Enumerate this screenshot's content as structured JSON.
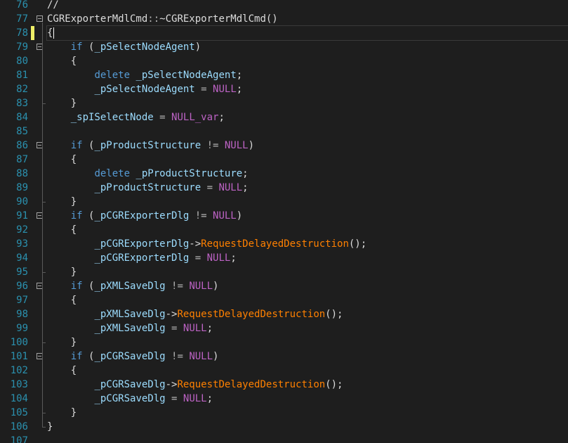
{
  "colors": {
    "background": "#1e1e1e",
    "line_number": "#2b91af",
    "keyword": "#569cd6",
    "variable": "#9cdcfe",
    "method": "#ff8000",
    "macro": "#bd63c5",
    "text": "#dcdcdc",
    "modified_marker": "#efef67",
    "saved_marker": "#57a64a",
    "guide": "#5a5a5a"
  },
  "editor": {
    "current_line": "78",
    "lines": [
      {
        "n": "76",
        "fold": false,
        "mark": "none",
        "tokens": [
          {
            "t": "//",
            "c": "def"
          }
        ]
      },
      {
        "n": "77",
        "fold": true,
        "mark": "none",
        "tokens": [
          {
            "t": "CGRExporterMdlCmd",
            "c": "fn"
          },
          {
            "t": "::",
            "c": "op"
          },
          {
            "t": "~CGRExporterMdlCmd",
            "c": "fn"
          },
          {
            "t": "()",
            "c": "punct"
          }
        ]
      },
      {
        "n": "78",
        "fold": false,
        "mark": "modified",
        "tokens": [
          {
            "t": "{",
            "c": "punct"
          }
        ]
      },
      {
        "n": "79",
        "fold": true,
        "mark": "none",
        "tokens": [
          {
            "t": "    ",
            "c": "def"
          },
          {
            "t": "if",
            "c": "kw"
          },
          {
            "t": " (",
            "c": "punct"
          },
          {
            "t": "_pSelectNodeAgent",
            "c": "var"
          },
          {
            "t": ")",
            "c": "punct"
          }
        ]
      },
      {
        "n": "80",
        "fold": false,
        "mark": "none",
        "tokens": [
          {
            "t": "    {",
            "c": "punct"
          }
        ]
      },
      {
        "n": "81",
        "fold": false,
        "mark": "none",
        "tokens": [
          {
            "t": "        ",
            "c": "def"
          },
          {
            "t": "delete",
            "c": "kw"
          },
          {
            "t": " ",
            "c": "def"
          },
          {
            "t": "_pSelectNodeAgent",
            "c": "var"
          },
          {
            "t": ";",
            "c": "punct"
          }
        ]
      },
      {
        "n": "82",
        "fold": false,
        "mark": "none",
        "tokens": [
          {
            "t": "        ",
            "c": "def"
          },
          {
            "t": "_pSelectNodeAgent",
            "c": "var"
          },
          {
            "t": " = ",
            "c": "op"
          },
          {
            "t": "NULL",
            "c": "macro"
          },
          {
            "t": ";",
            "c": "punct"
          }
        ]
      },
      {
        "n": "83",
        "fold": false,
        "mark": "none",
        "tokens": [
          {
            "t": "    }",
            "c": "punct"
          }
        ]
      },
      {
        "n": "84",
        "fold": false,
        "mark": "none",
        "tokens": [
          {
            "t": "    ",
            "c": "def"
          },
          {
            "t": "_spISelectNode",
            "c": "var"
          },
          {
            "t": " = ",
            "c": "op"
          },
          {
            "t": "NULL_var",
            "c": "macro"
          },
          {
            "t": ";",
            "c": "punct"
          }
        ]
      },
      {
        "n": "85",
        "fold": false,
        "mark": "none",
        "tokens": []
      },
      {
        "n": "86",
        "fold": true,
        "mark": "none",
        "tokens": [
          {
            "t": "    ",
            "c": "def"
          },
          {
            "t": "if",
            "c": "kw"
          },
          {
            "t": " (",
            "c": "punct"
          },
          {
            "t": "_pProductStructure",
            "c": "var"
          },
          {
            "t": " != ",
            "c": "op"
          },
          {
            "t": "NULL",
            "c": "macro"
          },
          {
            "t": ")",
            "c": "punct"
          }
        ]
      },
      {
        "n": "87",
        "fold": false,
        "mark": "none",
        "tokens": [
          {
            "t": "    {",
            "c": "punct"
          }
        ]
      },
      {
        "n": "88",
        "fold": false,
        "mark": "none",
        "tokens": [
          {
            "t": "        ",
            "c": "def"
          },
          {
            "t": "delete",
            "c": "kw"
          },
          {
            "t": " ",
            "c": "def"
          },
          {
            "t": "_pProductStructure",
            "c": "var"
          },
          {
            "t": ";",
            "c": "punct"
          }
        ]
      },
      {
        "n": "89",
        "fold": false,
        "mark": "none",
        "tokens": [
          {
            "t": "        ",
            "c": "def"
          },
          {
            "t": "_pProductStructure",
            "c": "var"
          },
          {
            "t": " = ",
            "c": "op"
          },
          {
            "t": "NULL",
            "c": "macro"
          },
          {
            "t": ";",
            "c": "punct"
          }
        ]
      },
      {
        "n": "90",
        "fold": false,
        "mark": "none",
        "tokens": [
          {
            "t": "    }",
            "c": "punct"
          }
        ]
      },
      {
        "n": "91",
        "fold": true,
        "mark": "none",
        "tokens": [
          {
            "t": "    ",
            "c": "def"
          },
          {
            "t": "if",
            "c": "kw"
          },
          {
            "t": " (",
            "c": "punct"
          },
          {
            "t": "_pCGRExporterDlg",
            "c": "var"
          },
          {
            "t": " != ",
            "c": "op"
          },
          {
            "t": "NULL",
            "c": "macro"
          },
          {
            "t": ")",
            "c": "punct"
          }
        ]
      },
      {
        "n": "92",
        "fold": false,
        "mark": "none",
        "tokens": [
          {
            "t": "    {",
            "c": "punct"
          }
        ]
      },
      {
        "n": "93",
        "fold": false,
        "mark": "none",
        "tokens": [
          {
            "t": "        ",
            "c": "def"
          },
          {
            "t": "_pCGRExporterDlg",
            "c": "var"
          },
          {
            "t": "->",
            "c": "ptr"
          },
          {
            "t": "RequestDelayedDestruction",
            "c": "method"
          },
          {
            "t": "();",
            "c": "punct"
          }
        ]
      },
      {
        "n": "94",
        "fold": false,
        "mark": "none",
        "tokens": [
          {
            "t": "        ",
            "c": "def"
          },
          {
            "t": "_pCGRExporterDlg",
            "c": "var"
          },
          {
            "t": " = ",
            "c": "op"
          },
          {
            "t": "NULL",
            "c": "macro"
          },
          {
            "t": ";",
            "c": "punct"
          }
        ]
      },
      {
        "n": "95",
        "fold": false,
        "mark": "none",
        "tokens": [
          {
            "t": "    }",
            "c": "punct"
          }
        ]
      },
      {
        "n": "96",
        "fold": true,
        "mark": "none",
        "tokens": [
          {
            "t": "    ",
            "c": "def"
          },
          {
            "t": "if",
            "c": "kw"
          },
          {
            "t": " (",
            "c": "punct"
          },
          {
            "t": "_pXMLSaveDlg",
            "c": "var"
          },
          {
            "t": " != ",
            "c": "op"
          },
          {
            "t": "NULL",
            "c": "macro"
          },
          {
            "t": ")",
            "c": "punct"
          }
        ]
      },
      {
        "n": "97",
        "fold": false,
        "mark": "none",
        "tokens": [
          {
            "t": "    {",
            "c": "punct"
          }
        ]
      },
      {
        "n": "98",
        "fold": false,
        "mark": "none",
        "tokens": [
          {
            "t": "        ",
            "c": "def"
          },
          {
            "t": "_pXMLSaveDlg",
            "c": "var"
          },
          {
            "t": "->",
            "c": "ptr"
          },
          {
            "t": "RequestDelayedDestruction",
            "c": "method"
          },
          {
            "t": "();",
            "c": "punct"
          }
        ]
      },
      {
        "n": "99",
        "fold": false,
        "mark": "none",
        "tokens": [
          {
            "t": "        ",
            "c": "def"
          },
          {
            "t": "_pXMLSaveDlg",
            "c": "var"
          },
          {
            "t": " = ",
            "c": "op"
          },
          {
            "t": "NULL",
            "c": "macro"
          },
          {
            "t": ";",
            "c": "punct"
          }
        ]
      },
      {
        "n": "100",
        "fold": false,
        "mark": "none",
        "tokens": [
          {
            "t": "    }",
            "c": "punct"
          }
        ]
      },
      {
        "n": "101",
        "fold": true,
        "mark": "none",
        "tokens": [
          {
            "t": "    ",
            "c": "def"
          },
          {
            "t": "if",
            "c": "kw"
          },
          {
            "t": " (",
            "c": "punct"
          },
          {
            "t": "_pCGRSaveDlg",
            "c": "var"
          },
          {
            "t": " != ",
            "c": "op"
          },
          {
            "t": "NULL",
            "c": "macro"
          },
          {
            "t": ")",
            "c": "punct"
          }
        ]
      },
      {
        "n": "102",
        "fold": false,
        "mark": "none",
        "tokens": [
          {
            "t": "    {",
            "c": "punct"
          }
        ]
      },
      {
        "n": "103",
        "fold": false,
        "mark": "none",
        "tokens": [
          {
            "t": "        ",
            "c": "def"
          },
          {
            "t": "_pCGRSaveDlg",
            "c": "var"
          },
          {
            "t": "->",
            "c": "ptr"
          },
          {
            "t": "RequestDelayedDestruction",
            "c": "method"
          },
          {
            "t": "();",
            "c": "punct"
          }
        ]
      },
      {
        "n": "104",
        "fold": false,
        "mark": "none",
        "tokens": [
          {
            "t": "        ",
            "c": "def"
          },
          {
            "t": "_pCGRSaveDlg",
            "c": "var"
          },
          {
            "t": " = ",
            "c": "op"
          },
          {
            "t": "NULL",
            "c": "macro"
          },
          {
            "t": ";",
            "c": "punct"
          }
        ]
      },
      {
        "n": "105",
        "fold": false,
        "mark": "none",
        "tokens": [
          {
            "t": "    }",
            "c": "punct"
          }
        ]
      },
      {
        "n": "106",
        "fold": false,
        "mark": "none",
        "tokens": [
          {
            "t": "}",
            "c": "punct"
          }
        ]
      },
      {
        "n": "107",
        "fold": false,
        "mark": "none",
        "tokens": []
      }
    ]
  }
}
